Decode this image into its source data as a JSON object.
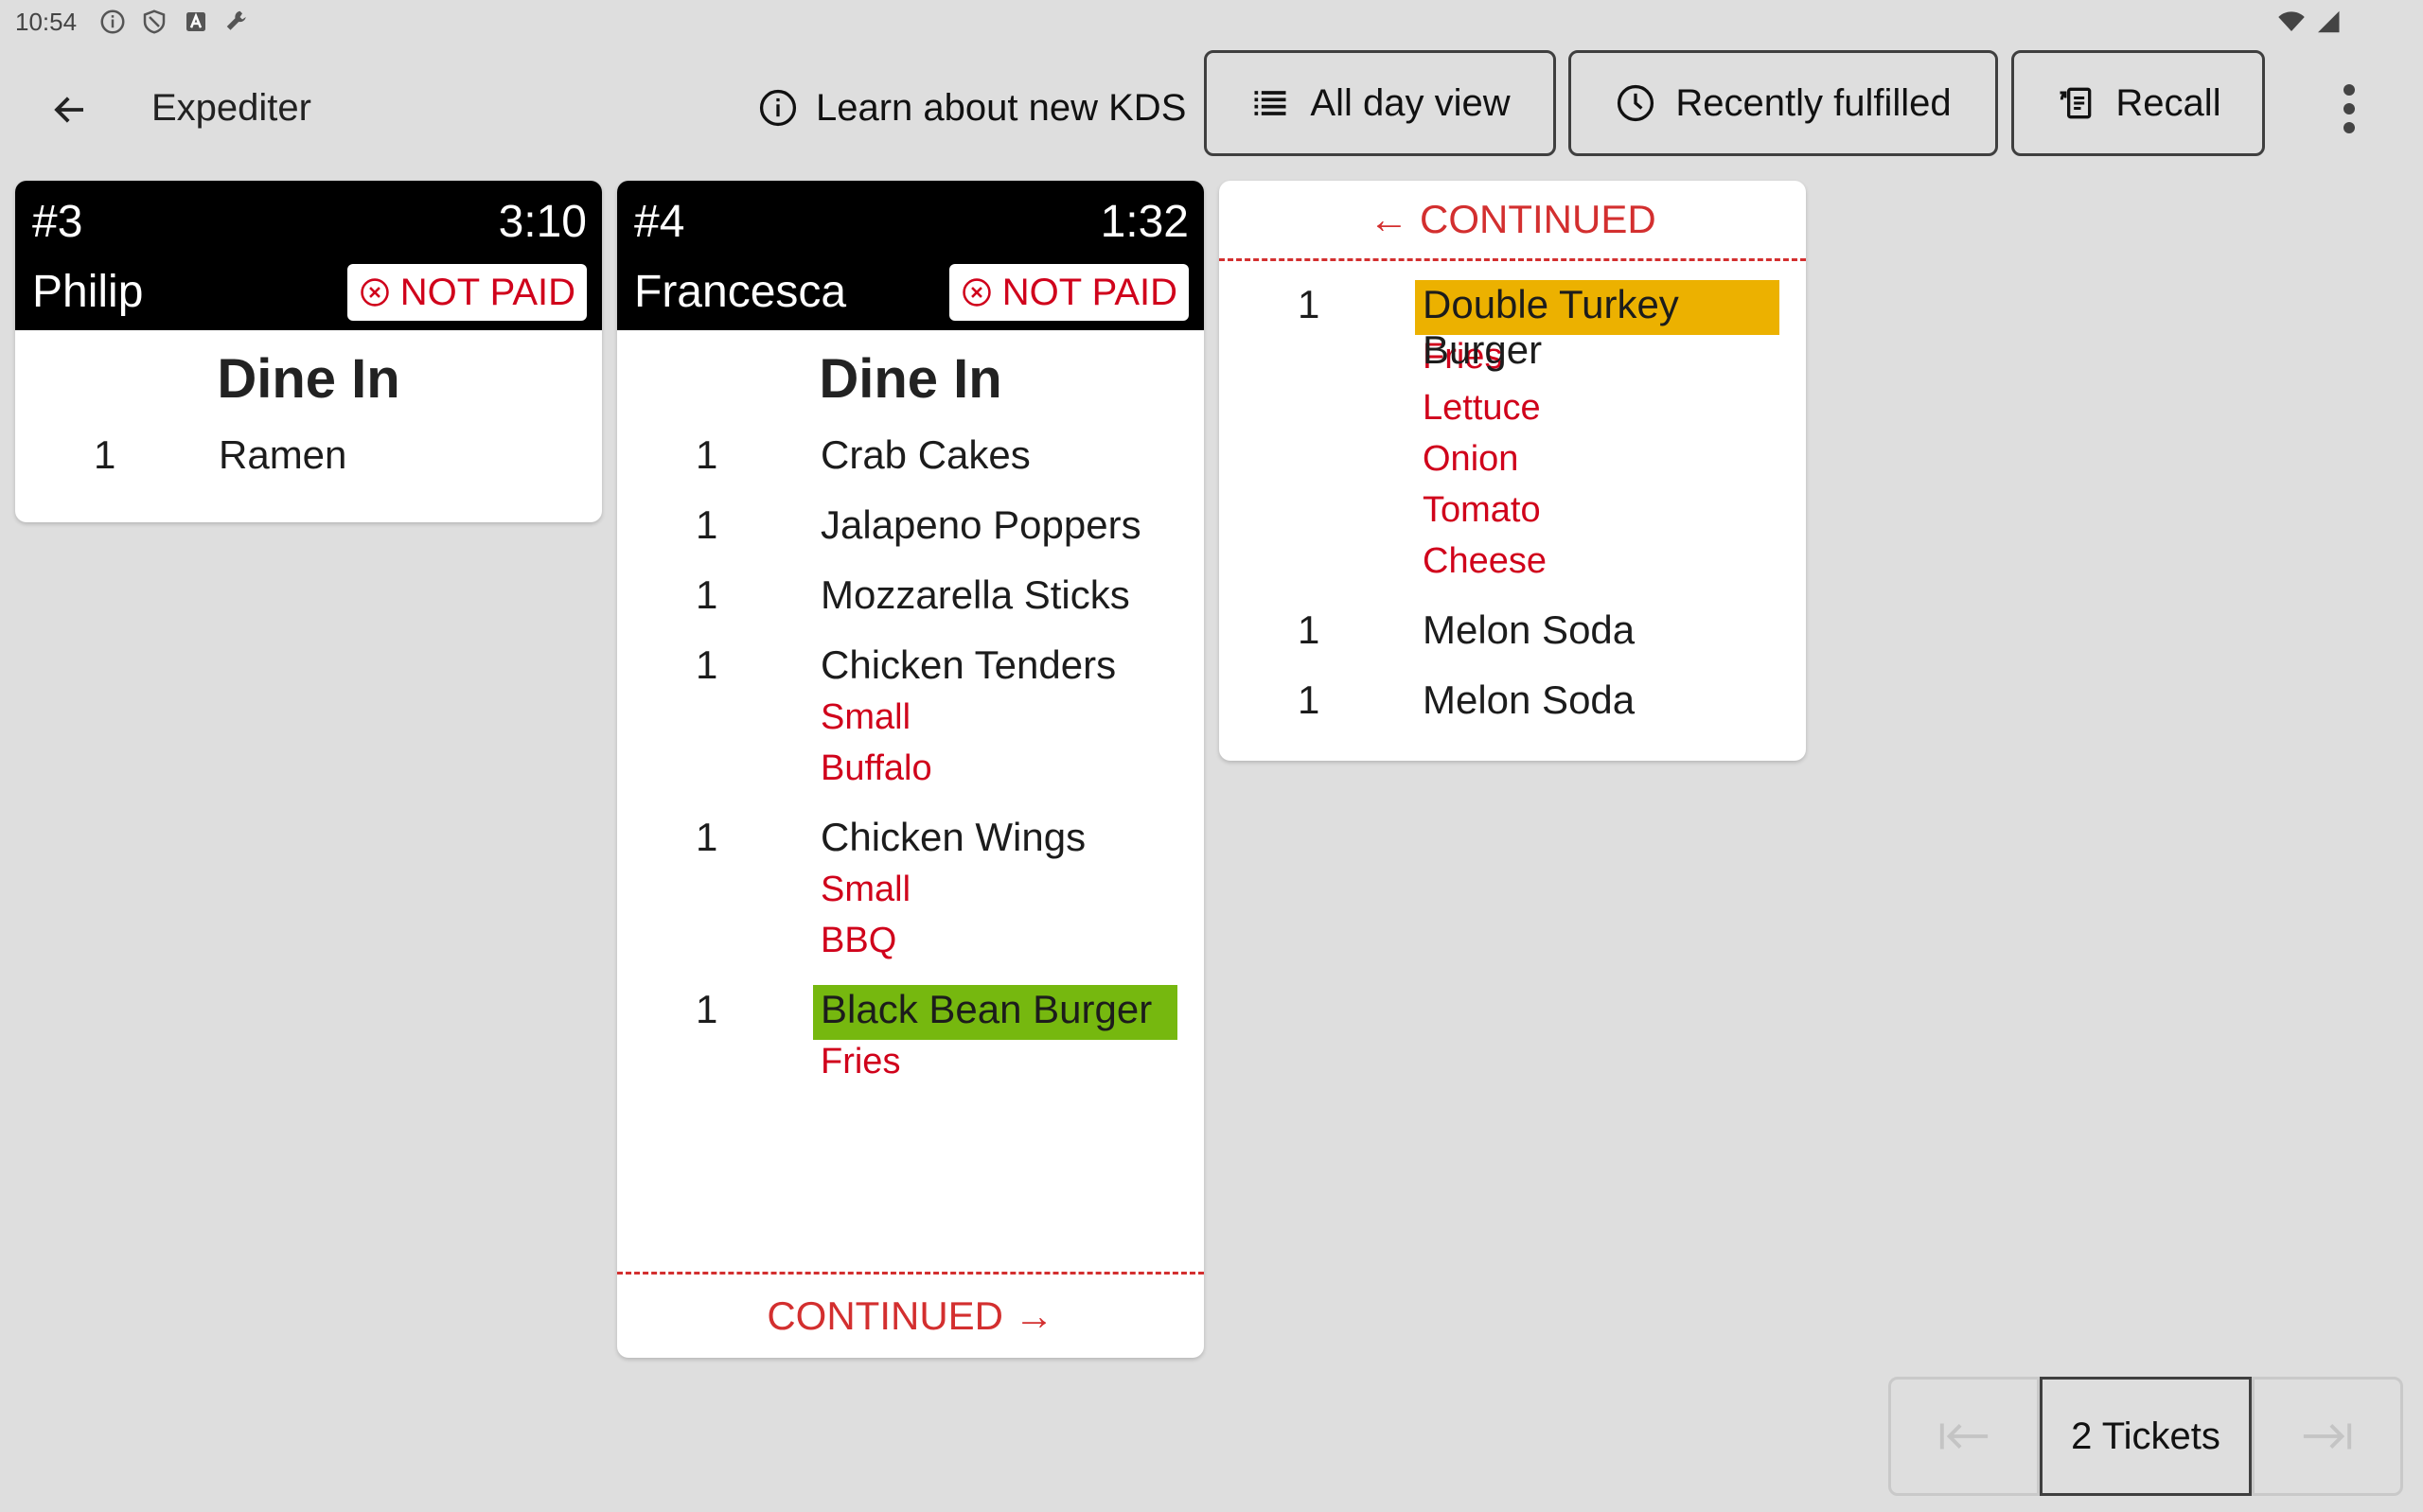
{
  "status_bar": {
    "time": "10:54",
    "icons": [
      "info-circle-icon",
      "shield-icon",
      "app-a-icon",
      "wrench-icon",
      "wifi-icon",
      "signal-icon"
    ]
  },
  "header": {
    "title": "Expediter",
    "learn_label": "Learn about new KDS",
    "all_day_label": "All day view",
    "recent_label": "Recently fulfilled",
    "recall_label": "Recall"
  },
  "tickets": [
    {
      "number": "#3",
      "time": "3:10",
      "customer": "Philip",
      "payment_status": "NOT PAID",
      "dining_option": "Dine In",
      "items": [
        {
          "qty": "1",
          "name": "Ramen"
        }
      ]
    },
    {
      "number": "#4",
      "time": "1:32",
      "customer": "Francesca",
      "payment_status": "NOT PAID",
      "dining_option": "Dine In",
      "items": [
        {
          "qty": "1",
          "name": "Crab Cakes"
        },
        {
          "qty": "1",
          "name": "Jalapeno Poppers"
        },
        {
          "qty": "1",
          "name": "Mozzarella Sticks"
        },
        {
          "qty": "1",
          "name": "Chicken Tenders",
          "modifiers": [
            "Small",
            "Buffalo"
          ]
        },
        {
          "qty": "1",
          "name": "Chicken Wings",
          "modifiers": [
            "Small",
            "BBQ"
          ]
        },
        {
          "qty": "1",
          "name": "Black Bean Burger",
          "modifiers": [
            "Fries"
          ],
          "highlight": "#76b80f"
        }
      ],
      "continued_bottom": "CONTINUED →"
    },
    {
      "continued_top": "← CONTINUED",
      "items": [
        {
          "qty": "1",
          "name": "Double Turkey Burger",
          "modifiers": [
            "Fries",
            "Lettuce",
            "Onion",
            "Tomato",
            "Cheese"
          ],
          "highlight": "#ecb100"
        },
        {
          "qty": "1",
          "name": "Melon Soda"
        },
        {
          "qty": "1",
          "name": "Melon Soda"
        }
      ]
    }
  ],
  "pager": {
    "count_label": "2 Tickets"
  },
  "colors": {
    "modifier": "#d0021b",
    "continued": "#d32f2f",
    "highlight_green": "#76b80f",
    "highlight_yellow": "#ecb100"
  }
}
